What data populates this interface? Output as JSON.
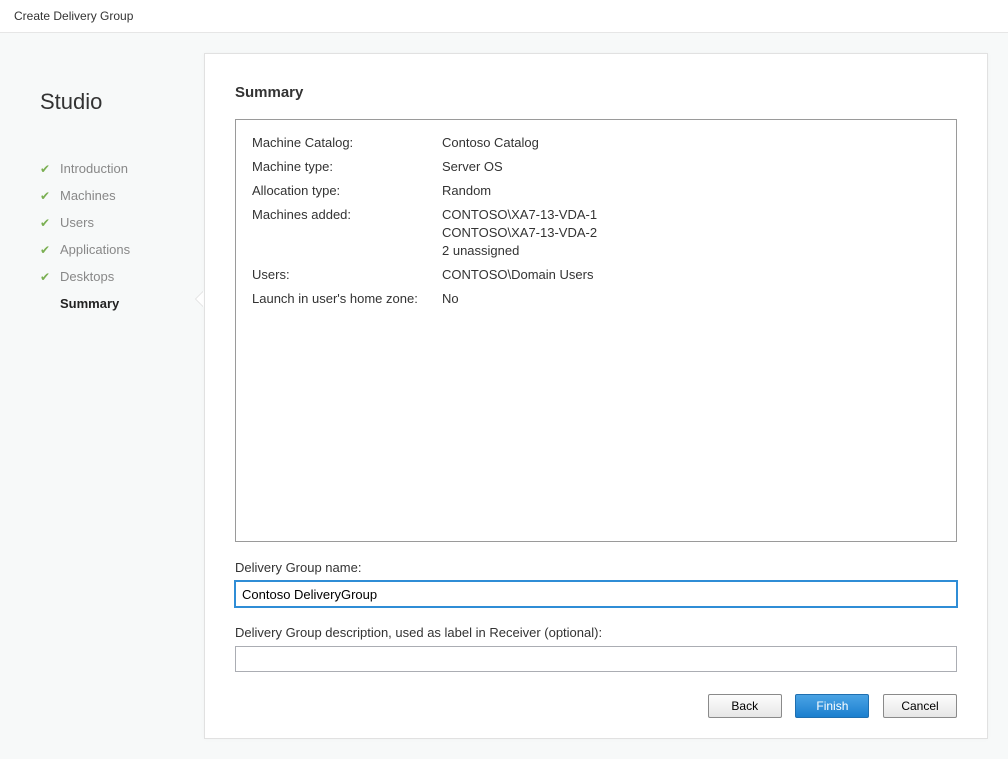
{
  "window": {
    "title": "Create Delivery Group"
  },
  "brand": "Studio",
  "steps": [
    {
      "label": "Introduction",
      "done": true,
      "current": false
    },
    {
      "label": "Machines",
      "done": true,
      "current": false
    },
    {
      "label": "Users",
      "done": true,
      "current": false
    },
    {
      "label": "Applications",
      "done": true,
      "current": false
    },
    {
      "label": "Desktops",
      "done": true,
      "current": false
    },
    {
      "label": "Summary",
      "done": false,
      "current": true
    }
  ],
  "page": {
    "heading": "Summary",
    "summary": {
      "machine_catalog_label": "Machine Catalog:",
      "machine_catalog_value": "Contoso Catalog",
      "machine_type_label": "Machine type:",
      "machine_type_value": "Server OS",
      "allocation_type_label": "Allocation type:",
      "allocation_type_value": "Random",
      "machines_added_label": "Machines added:",
      "machines_added_line1": "CONTOSO\\XA7-13-VDA-1",
      "machines_added_line2": "CONTOSO\\XA7-13-VDA-2",
      "machines_added_line3": "2 unassigned",
      "users_label": "Users:",
      "users_value": "CONTOSO\\Domain Users",
      "home_zone_label": "Launch in user's home zone:",
      "home_zone_value": "No"
    },
    "name_field": {
      "label": "Delivery Group name:",
      "value": "Contoso DeliveryGroup"
    },
    "desc_field": {
      "label": "Delivery Group description, used as label in Receiver (optional):",
      "value": ""
    }
  },
  "buttons": {
    "back": "Back",
    "finish": "Finish",
    "cancel": "Cancel"
  }
}
